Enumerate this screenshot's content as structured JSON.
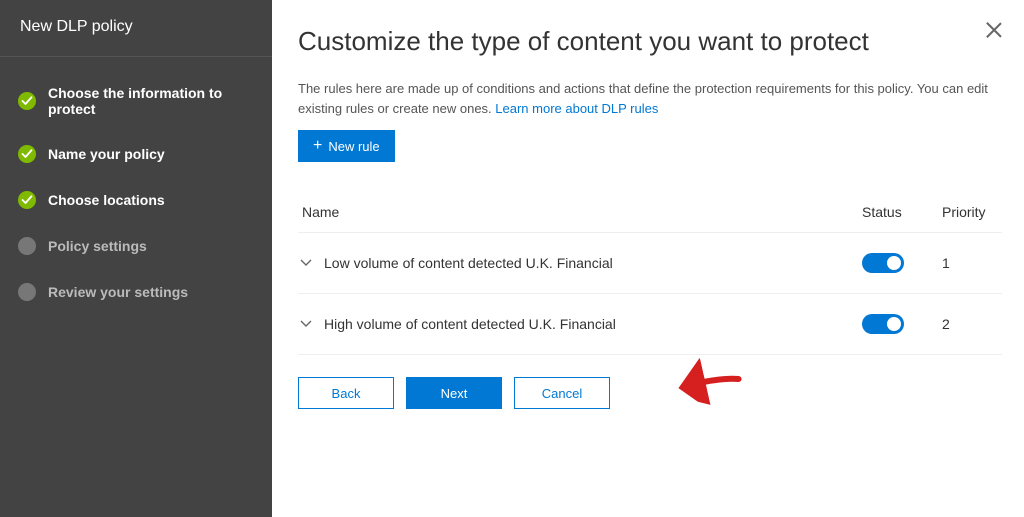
{
  "sidebar": {
    "title": "New DLP policy",
    "steps": [
      {
        "label": "Choose the information to protect",
        "state": "done"
      },
      {
        "label": "Name your policy",
        "state": "done"
      },
      {
        "label": "Choose locations",
        "state": "done"
      },
      {
        "label": "Policy settings",
        "state": "pending"
      },
      {
        "label": "Review your settings",
        "state": "pending"
      }
    ]
  },
  "main": {
    "title": "Customize the type of content you want to protect",
    "description": "The rules here are made up of conditions and actions that define the protection requirements for this policy. You can edit existing rules or create new ones. ",
    "learn_link": "Learn more about DLP rules",
    "new_rule_label": "New rule",
    "columns": {
      "name": "Name",
      "status": "Status",
      "priority": "Priority"
    },
    "rules": [
      {
        "name": "Low volume of content detected U.K. Financial",
        "status_on": true,
        "priority": "1"
      },
      {
        "name": "High volume of content detected U.K. Financial",
        "status_on": true,
        "priority": "2"
      }
    ],
    "buttons": {
      "back": "Back",
      "next": "Next",
      "cancel": "Cancel"
    }
  },
  "colors": {
    "primary": "#0078d4",
    "success": "#7fba00"
  }
}
